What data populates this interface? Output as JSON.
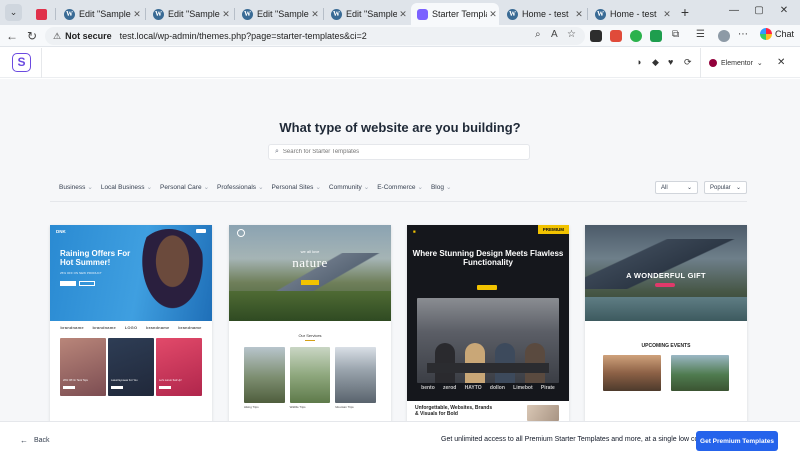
{
  "browser": {
    "tabs": [
      {
        "title": "",
        "favicon": "red-icon"
      },
      {
        "title": "Edit \"Sample Page\"",
        "favicon": "wordpress-icon"
      },
      {
        "title": "Edit \"Sample Page\"",
        "favicon": "wordpress-icon"
      },
      {
        "title": "Edit \"Sample Page\"",
        "favicon": "wordpress-icon"
      },
      {
        "title": "Edit \"Sample Page\"",
        "favicon": "wordpress-icon"
      },
      {
        "title": "Starter Templates",
        "favicon": "starter-templates-icon",
        "active": true
      },
      {
        "title": "Home - test",
        "favicon": "wordpress-icon"
      },
      {
        "title": "Home - test",
        "favicon": "wordpress-icon"
      }
    ],
    "new_tab": "+",
    "window": {
      "minimize": "—",
      "maximize": "▢",
      "close": "✕"
    },
    "address": {
      "security_label": "Not secure",
      "url": "test.local/wp-admin/themes.php?page=starter-templates&ci=2"
    },
    "chat_label": "Chat"
  },
  "app": {
    "logo_letter": "S",
    "builder": {
      "label": "Elementor"
    }
  },
  "main": {
    "heading": "What type of website are you building?",
    "search_placeholder": "Search for Starter Templates",
    "categories": [
      "Business",
      "Local Business",
      "Personal Care",
      "Professionals",
      "Personal Sites",
      "Community",
      "E-Commerce",
      "Blog"
    ],
    "filter_all": "All",
    "sort": "Popular"
  },
  "cards": {
    "c1": {
      "logo": "DNK",
      "title": "Raining Offers For Hot Summer!",
      "sub": "25% OFF ON NEW PRODUCT",
      "brands": [
        "brandname",
        "brandname",
        "LOGO",
        "brandname",
        "brandname"
      ],
      "tiles": [
        "20% Off On Tank Tops",
        "Latest Eyewear For You",
        "Let's Lorem Suit Up!"
      ]
    },
    "c2": {
      "tagline": "we all love",
      "title": "nature",
      "section": "Our Services",
      "services": [
        "Hiking Trips",
        "Wildlife Trips",
        "Mountain Trips"
      ]
    },
    "c3": {
      "badge": "PREMIUM",
      "title": "Where Stunning Design Meets Flawless Functionality",
      "brands": [
        "bento",
        "zerod",
        "HAYTO",
        "dollon",
        "Limebot",
        "Pirate"
      ],
      "bottom": "Unforgettable, Websites, Brands & Visuals for Bold"
    },
    "c4": {
      "title": "A WONDERFUL GIFT",
      "events": "UPCOMING EVENTS"
    }
  },
  "footer": {
    "back": "Back",
    "upsell": "Get unlimited access to all Premium Starter Templates and more, at a single low cost!",
    "cta": "Get Premium Templates"
  }
}
